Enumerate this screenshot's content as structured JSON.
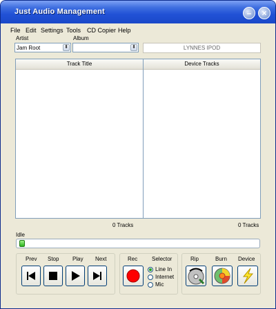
{
  "window": {
    "title": "Just Audio Management"
  },
  "menu": [
    "File",
    "Edit",
    "Settings",
    "Tools",
    "CD Copier",
    "Help"
  ],
  "selectors": {
    "artist_label": "Artist",
    "artist_value": "Jam Root",
    "album_label": "Album",
    "album_value": "",
    "device_name": "LYNNES IPOD"
  },
  "tracks": {
    "left_header": "Track Title",
    "right_header": "Device Tracks",
    "left_count": "0 Tracks",
    "right_count": "0 Tracks"
  },
  "status": {
    "text": "Idle",
    "progress_fraction": 0.0
  },
  "transport": {
    "prev": "Prev",
    "stop": "Stop",
    "play": "Play",
    "next": "Next"
  },
  "record": {
    "rec": "Rec",
    "selector": "Selector",
    "options": [
      "Line In",
      "Internet",
      "Mic"
    ],
    "selected": "Line In"
  },
  "actions": {
    "rip": "Rip",
    "burn": "Burn",
    "device": "Device"
  },
  "colors": {
    "title_bar": "#2151d6",
    "rec_red": "#ff0000",
    "progress_green": "#2bb41f"
  }
}
